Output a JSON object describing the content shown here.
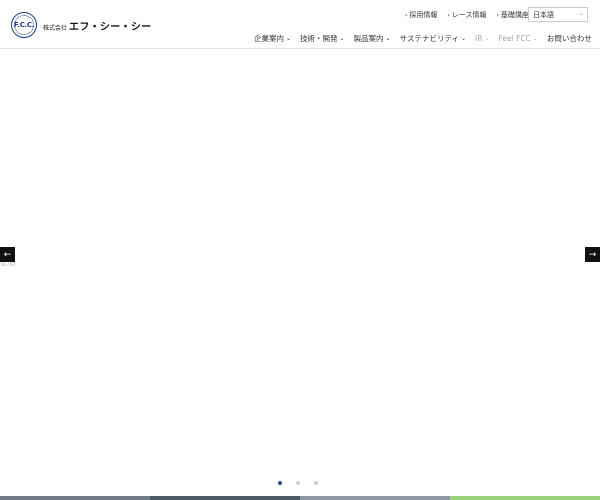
{
  "header": {
    "logo": {
      "seal_text": "F.C.C.",
      "company_prefix": "株式会社",
      "company_name": "エフ・シー・シー"
    },
    "utility_links": [
      {
        "label": "採用情報"
      },
      {
        "label": "レース情報"
      },
      {
        "label": "基礎講座"
      }
    ],
    "language_select": {
      "value": "日本語"
    },
    "nav": [
      {
        "label": "企業案内",
        "caret": true,
        "muted": false
      },
      {
        "label": "技術・開発",
        "caret": true,
        "muted": false
      },
      {
        "label": "製品案内",
        "caret": true,
        "muted": false
      },
      {
        "label": "サステナビリティ",
        "caret": true,
        "muted": false
      },
      {
        "label": "IR",
        "caret": true,
        "muted": true
      },
      {
        "label": "Feel FCC",
        "caret": true,
        "muted": true
      },
      {
        "label": "お問い合わせ",
        "caret": false,
        "muted": false
      }
    ]
  },
  "hero": {
    "prev_icon": "←",
    "next_icon": "→",
    "slide_counter": "01 / 03",
    "slides": {
      "count": 3,
      "active_index": 0
    },
    "strip_colors": [
      "#6f7a85",
      "#4b5a66",
      "#8e99a3",
      "#9bd37a"
    ]
  },
  "icons": {
    "utility_caret": "›",
    "nav_caret": "⌄",
    "lang_caret": "⌄"
  }
}
